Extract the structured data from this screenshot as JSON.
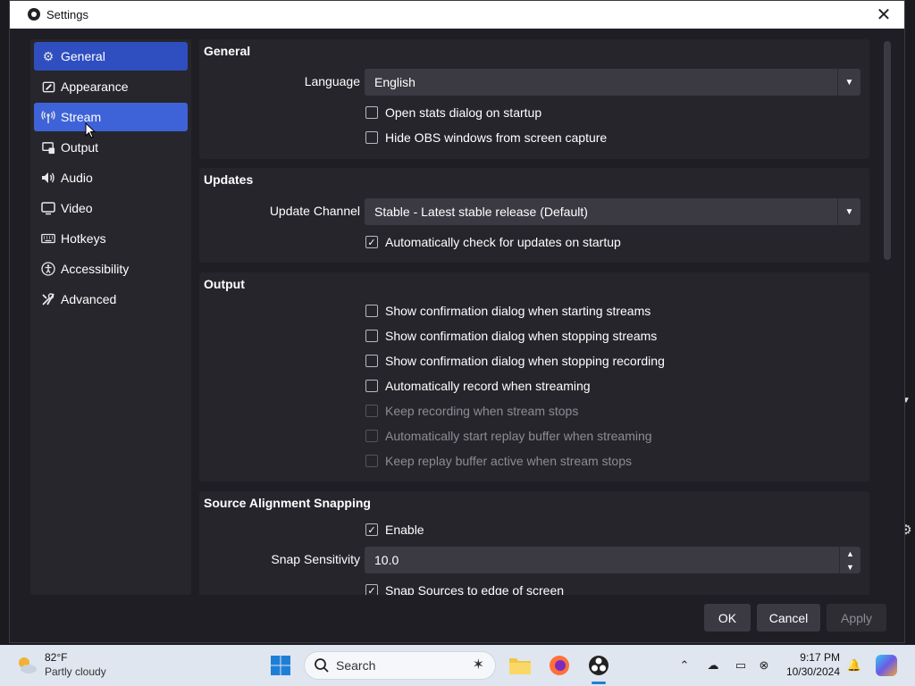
{
  "window": {
    "title": "Settings"
  },
  "sidebar": {
    "items": [
      {
        "label": "General",
        "icon": "gear-icon"
      },
      {
        "label": "Appearance",
        "icon": "paint-brush-icon"
      },
      {
        "label": "Stream",
        "icon": "broadcast-antenna-icon"
      },
      {
        "label": "Output",
        "icon": "output-monitor-icon"
      },
      {
        "label": "Audio",
        "icon": "speaker-icon"
      },
      {
        "label": "Video",
        "icon": "monitor-icon"
      },
      {
        "label": "Hotkeys",
        "icon": "keyboard-icon"
      },
      {
        "label": "Accessibility",
        "icon": "accessibility-icon"
      },
      {
        "label": "Advanced",
        "icon": "tools-icon"
      }
    ],
    "selected": "General",
    "hovered": "Stream"
  },
  "general": {
    "title": "General",
    "language_label": "Language",
    "language_value": "English",
    "open_stats": {
      "label": "Open stats dialog on startup",
      "checked": false
    },
    "hide_obs": {
      "label": "Hide OBS windows from screen capture",
      "checked": false
    }
  },
  "updates": {
    "title": "Updates",
    "channel_label": "Update Channel",
    "channel_value": "Stable - Latest stable release (Default)",
    "auto_check": {
      "label": "Automatically check for updates on startup",
      "checked": true
    }
  },
  "output": {
    "title": "Output",
    "options": [
      {
        "label": "Show confirmation dialog when starting streams",
        "checked": false,
        "enabled": true
      },
      {
        "label": "Show confirmation dialog when stopping streams",
        "checked": false,
        "enabled": true
      },
      {
        "label": "Show confirmation dialog when stopping recording",
        "checked": false,
        "enabled": true
      },
      {
        "label": "Automatically record when streaming",
        "checked": false,
        "enabled": true
      },
      {
        "label": "Keep recording when stream stops",
        "checked": false,
        "enabled": false
      },
      {
        "label": "Automatically start replay buffer when streaming",
        "checked": false,
        "enabled": false
      },
      {
        "label": "Keep replay buffer active when stream stops",
        "checked": false,
        "enabled": false
      }
    ]
  },
  "snapping": {
    "title": "Source Alignment Snapping",
    "enable": {
      "label": "Enable",
      "checked": true
    },
    "sensitivity_label": "Snap Sensitivity",
    "sensitivity_value": "10.0",
    "snap_edges": {
      "label": "Snap Sources to edge of screen",
      "checked": true
    }
  },
  "buttons": {
    "ok": "OK",
    "cancel": "Cancel",
    "apply": "Apply"
  },
  "taskbar": {
    "weather_temp": "82°F",
    "weather_desc": "Partly cloudy",
    "search_placeholder": "Search",
    "time": "9:17 PM",
    "date": "10/30/2024"
  }
}
